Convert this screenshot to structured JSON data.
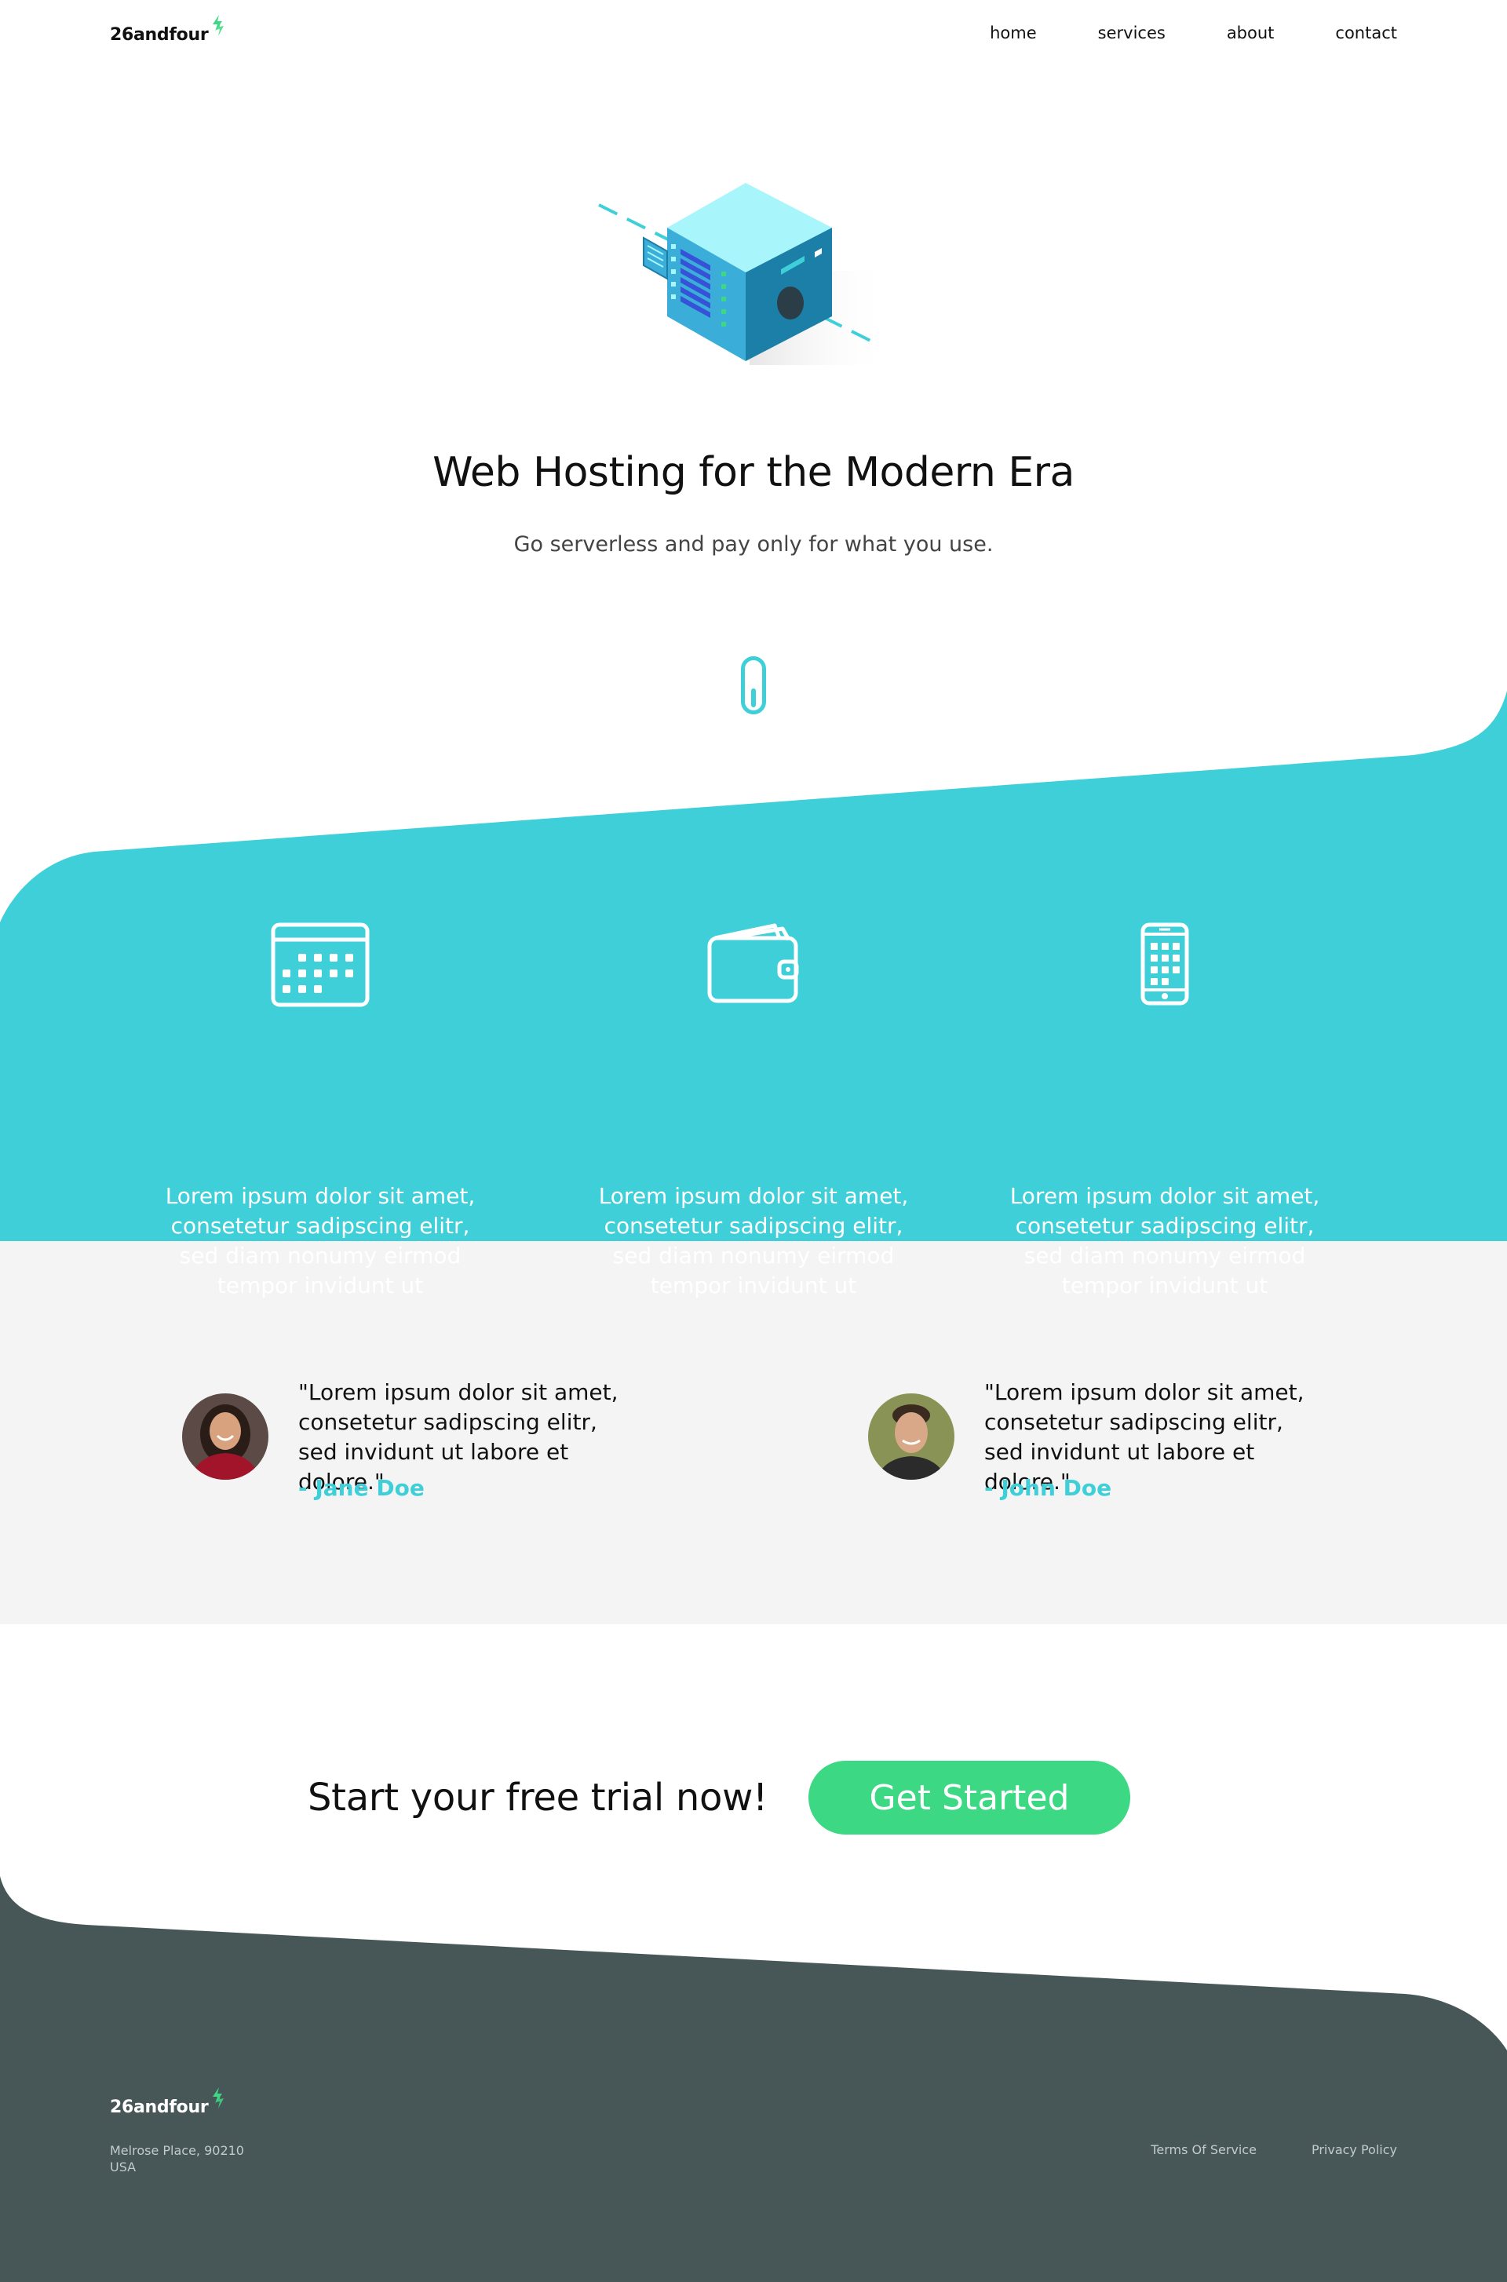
{
  "brand": {
    "name": "26andfour",
    "accent": "#3dd884",
    "bolt_color": "#3dd884"
  },
  "nav": {
    "items": [
      "home",
      "services",
      "about",
      "contact"
    ]
  },
  "hero": {
    "title": "Web Hosting for the Modern Era",
    "subtitle": "Go serverless and pay only for what you use.",
    "illustration": "server-cube-icon",
    "scroll_icon": "mouse-scroll-icon"
  },
  "colors": {
    "teal": "#3ecfd8",
    "green": "#3dd884",
    "light_gray": "#f4f4f4",
    "footer_dark": "#475656"
  },
  "features": [
    {
      "icon": "calendar-icon",
      "text": "Lorem ipsum dolor sit amet, consetetur sadipscing elitr, sed diam nonumy eirmod tempor invidunt ut"
    },
    {
      "icon": "wallet-icon",
      "text": "Lorem ipsum dolor sit amet, consetetur sadipscing elitr, sed diam nonumy eirmod tempor invidunt ut"
    },
    {
      "icon": "smartphone-icon",
      "text": "Lorem ipsum dolor sit amet, consetetur sadipscing elitr, sed diam nonumy eirmod tempor invidunt ut"
    }
  ],
  "testimonials": [
    {
      "quote": "\"Lorem ipsum dolor sit amet, consetetur sadipscing elitr, sed invidunt ut labore et dolore.\"",
      "author": "- Jane Doe"
    },
    {
      "quote": "\"Lorem ipsum dolor sit amet, consetetur sadipscing elitr, sed invidunt ut labore et dolore.\"",
      "author": "- John Doe"
    }
  ],
  "cta": {
    "text": "Start your free trial now!",
    "button_label": "Get Started"
  },
  "footer": {
    "address_line1": "Melrose Place, 90210",
    "address_line2": "USA",
    "links": [
      "Terms Of Service",
      "Privacy Policy"
    ]
  }
}
